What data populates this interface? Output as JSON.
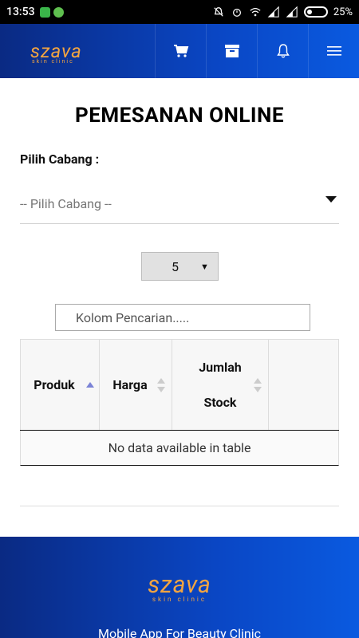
{
  "status_bar": {
    "time": "13:53",
    "battery_percent": "25%"
  },
  "header": {
    "brand": "szava",
    "brand_sub": "skin clinic",
    "nav_icons": [
      "cart-icon",
      "archive-icon",
      "bell-icon",
      "menu-icon"
    ]
  },
  "page": {
    "title": "PEMESANAN ONLINE",
    "branch_label": "Pilih Cabang :",
    "branch_placeholder": "-- Pilih Cabang --",
    "page_size": "5",
    "search_placeholder": "Kolom Pencarian....."
  },
  "table": {
    "columns": [
      "Produk",
      "Harga",
      "Jumlah Stock",
      ""
    ],
    "empty_message": "No data available in table"
  },
  "footer": {
    "brand": "szava",
    "brand_sub": "skin clinic",
    "tagline": "Mobile App For Beauty Clinic"
  },
  "colors": {
    "header_blue": "#0a46c4",
    "brand_orange": "#f2a441",
    "sort_active": "#7b83d6"
  }
}
